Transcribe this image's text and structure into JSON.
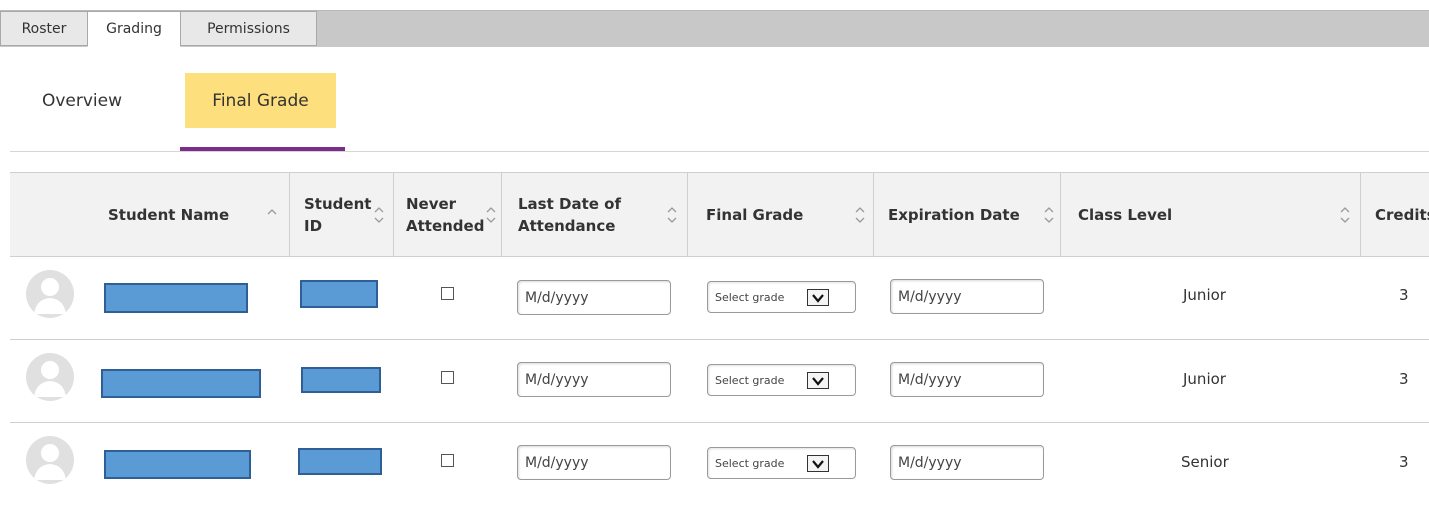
{
  "top_tabs": [
    "Roster",
    "Grading",
    "Permissions"
  ],
  "active_top_tab": "Grading",
  "sub_tabs": [
    "Overview",
    "Final Grade"
  ],
  "active_sub_tab": "Final Grade",
  "columns": {
    "student_name": "Student Name",
    "student_id_1": "Student",
    "student_id_2": "ID",
    "never_1": "Never",
    "never_2": "Attended",
    "last_date_1": "Last Date of",
    "last_date_2": "Attendance",
    "final_grade": "Final Grade",
    "expiration_date": "Expiration Date",
    "class_level": "Class Level",
    "credits": "Credits"
  },
  "rows": [
    {
      "last_date_placeholder": "M/d/yyyy",
      "grade_select": "Select grade",
      "expiration_placeholder": "M/d/yyyy",
      "class_level": "Junior",
      "credits": "3"
    },
    {
      "last_date_placeholder": "M/d/yyyy",
      "grade_select": "Select grade",
      "expiration_placeholder": "M/d/yyyy",
      "class_level": "Junior",
      "credits": "3"
    },
    {
      "last_date_placeholder": "M/d/yyyy",
      "grade_select": "Select grade",
      "expiration_placeholder": "M/d/yyyy",
      "class_level": "Senior",
      "credits": "3"
    }
  ],
  "colors": {
    "active_subtab_bg": "#fddf7e",
    "subtab_underline": "#7b2d8b",
    "redaction_fill": "#5b9bd5",
    "redaction_border": "#2f5f96"
  }
}
